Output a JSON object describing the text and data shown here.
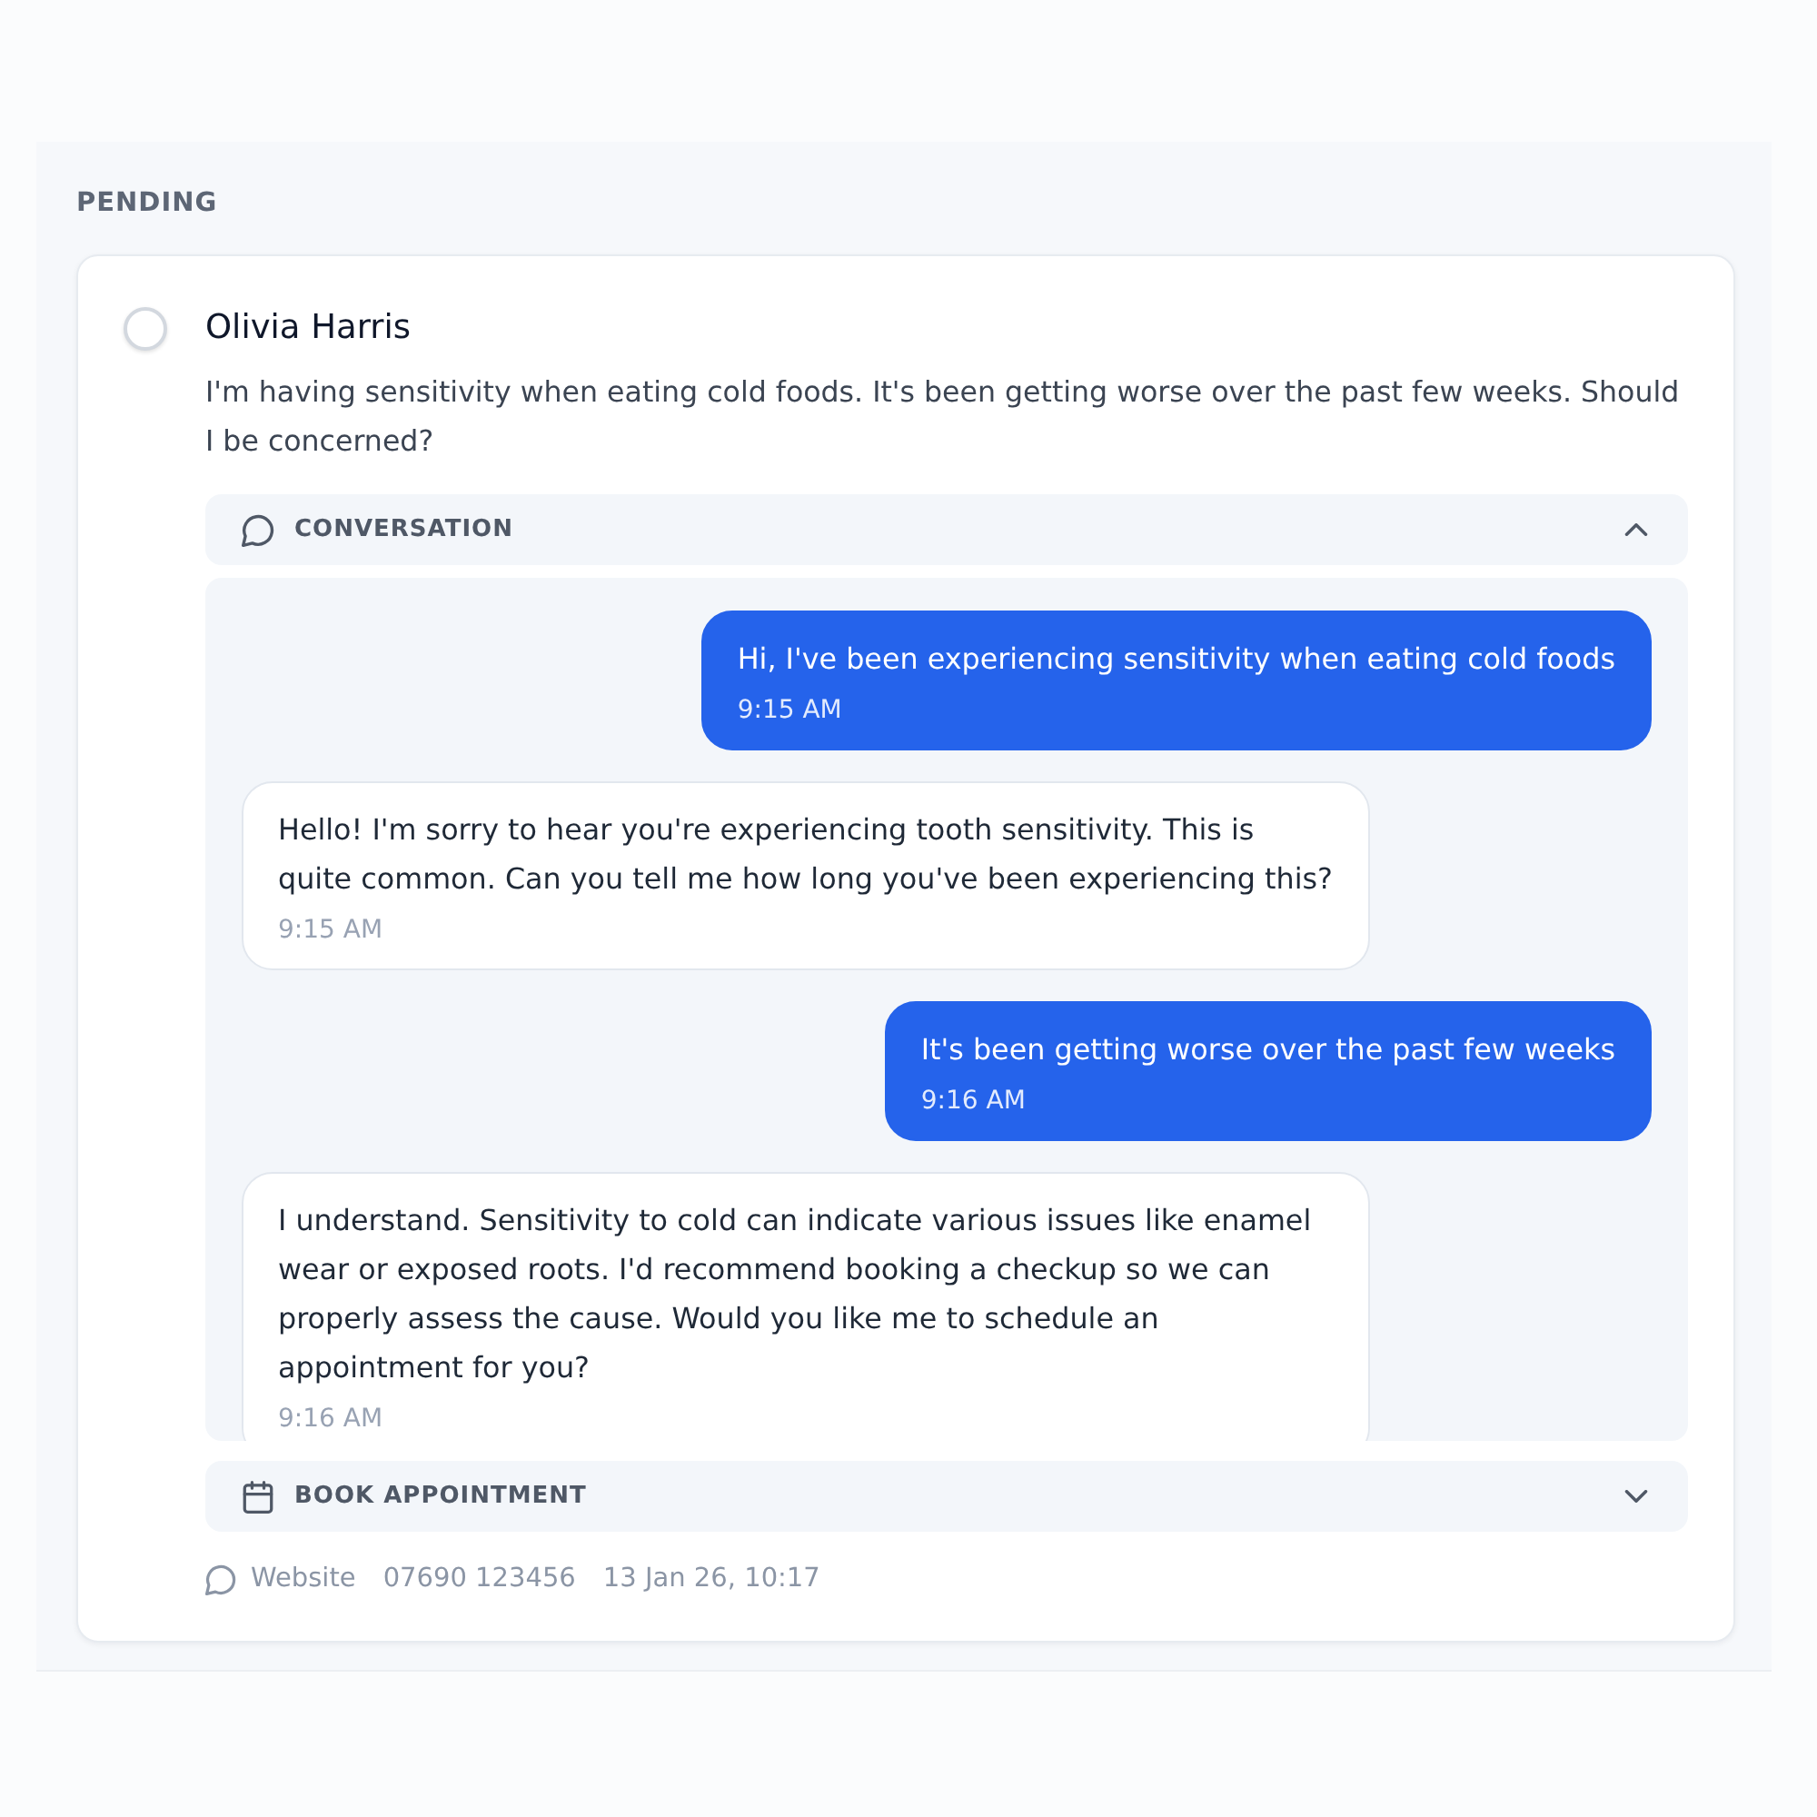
{
  "section": {
    "title": "PENDING"
  },
  "ticket": {
    "checked": false,
    "name": "Olivia Harris",
    "message": "I'm having sensitivity when eating cold foods. It's been getting worse over the past few weeks. Should I be concerned?",
    "panels": [
      {
        "kind": "conversation",
        "title": "CONVERSATION",
        "expanded": true,
        "messages": [
          {
            "kind": "outgoing",
            "text": "Hi, I've been experiencing sensitivity when eating cold foods",
            "time": "9:15 AM"
          },
          {
            "kind": "incoming",
            "text": "Hello! I'm sorry to hear you're experiencing tooth sensitivity. This is quite common. Can you tell me how long you've been experiencing this?",
            "time": "9:15 AM"
          },
          {
            "kind": "outgoing",
            "text": "It's been getting worse over the past few weeks",
            "time": "9:16 AM"
          },
          {
            "kind": "incoming",
            "text": "I understand. Sensitivity to cold can indicate various issues like enamel wear or exposed roots. I'd recommend booking a checkup so we can properly assess the cause. Would you like me to schedule an appointment for you?",
            "time": "9:16 AM"
          }
        ]
      },
      {
        "kind": "booking",
        "title": "BOOK APPOINTMENT",
        "expanded": false
      }
    ],
    "meta": {
      "channel": "Website",
      "phone": "07690 123456",
      "date": "13 Jan 26, 10:17"
    }
  }
}
